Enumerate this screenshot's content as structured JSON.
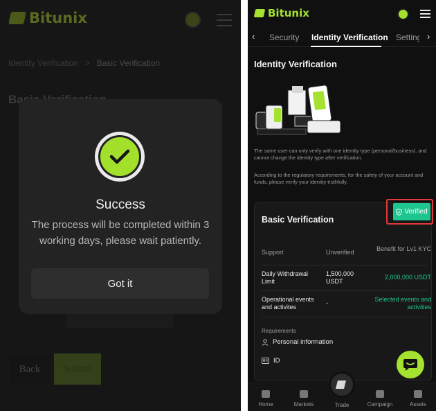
{
  "left": {
    "brand": "Bitunix",
    "breadcrumb": {
      "parent": "Identity Verification",
      "separator": ">",
      "current": "Basic Verification"
    },
    "title": "Basic Verification",
    "back_label": "Back",
    "submit_label": "Submit",
    "modal": {
      "title": "Success",
      "message": "The process will be completed within 3 working days, please wait patiently.",
      "button": "Got it"
    }
  },
  "right": {
    "brand": "Bitunix",
    "tabs": [
      {
        "label": "Security"
      },
      {
        "label": "Identity Verification",
        "active": true
      },
      {
        "label": "Setting"
      }
    ],
    "heading": "Identity Verification",
    "note1": "The same user can only verify with one identity type (personal/business), and cannot change the identity type after verification.",
    "note2": "According to the regulatory requirements, for the safety of your account and funds, please verify your identity truthfully.",
    "card": {
      "title": "Basic Verification",
      "badge": "Verified",
      "columns": [
        "Support",
        "Unverified",
        "Benefit for Lv1 KYC"
      ],
      "rows": [
        {
          "support": "Daily Withdrawal Limit",
          "unverified": "1,500,000 USDT",
          "benefit": "2,000,000  USDT"
        },
        {
          "support": "Operational events and activites",
          "unverified": "-",
          "benefit": "Selected events and activities"
        }
      ],
      "requirements_label": "Requirements",
      "requirements": [
        "Personal information",
        "ID"
      ]
    },
    "nav": [
      "Home",
      "Markets",
      "Trade",
      "Campaign",
      "Assets"
    ]
  },
  "colors": {
    "accent": "#a4e22f",
    "verified": "#1ec58f",
    "highlight": "#e23a3a"
  }
}
